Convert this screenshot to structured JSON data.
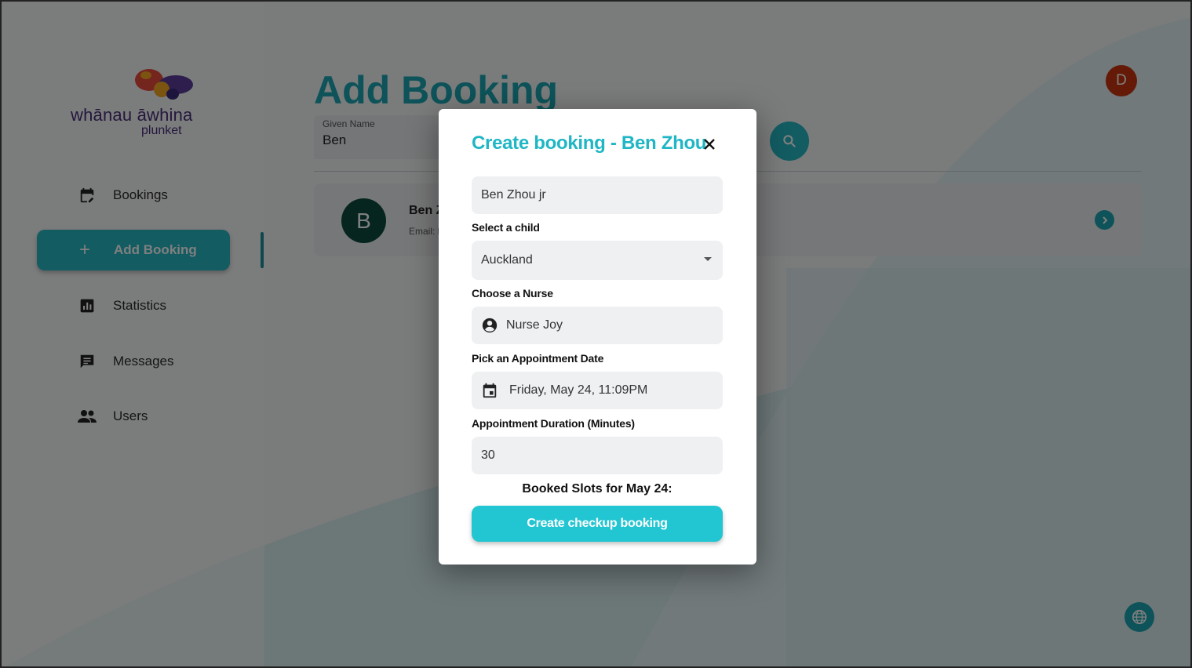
{
  "brand": {
    "line1": "whānau āwhina",
    "line2": "plunket"
  },
  "sidebar": {
    "items": [
      {
        "label": "Bookings",
        "icon": "calendar-edit-icon"
      },
      {
        "label": "Add Booking",
        "icon": "plus-icon",
        "active": true
      },
      {
        "label": "Statistics",
        "icon": "bar-chart-icon"
      },
      {
        "label": "Messages",
        "icon": "message-icon"
      },
      {
        "label": "Users",
        "icon": "users-icon"
      }
    ]
  },
  "main": {
    "title": "Add Booking",
    "given_name_label": "Given Name",
    "given_name_value": "Ben",
    "result": {
      "avatar_letter": "B",
      "name": "Ben Z",
      "email_label": "Email: l"
    }
  },
  "user": {
    "avatar_letter": "D"
  },
  "modal": {
    "title": "Create booking - Ben Zhou",
    "patient_value": "Ben Zhou jr",
    "child_label": "Select a child",
    "child_value": "Auckland",
    "nurse_label": "Choose a Nurse",
    "nurse_value": "Nurse Joy",
    "date_label": "Pick an Appointment Date",
    "date_value": "Friday, May 24, 11:09PM",
    "duration_label": "Appointment Duration (Minutes)",
    "duration_value": "30",
    "booked_slots": "Booked Slots for May 24:",
    "submit_label": "Create checkup booking"
  },
  "colors": {
    "accent": "#25b8c4",
    "title": "#1aa7b3",
    "avatar": "#c8350f"
  }
}
